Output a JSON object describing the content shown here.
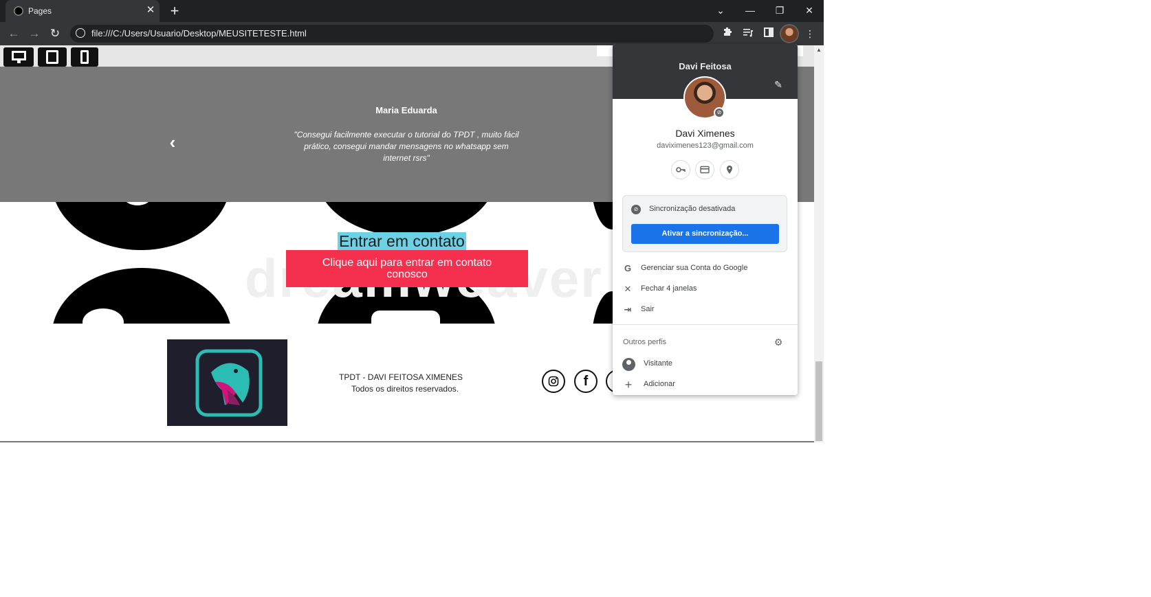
{
  "browser": {
    "tab_title": "Pages",
    "tab_close": "✕",
    "new_tab": "+",
    "url": "file:///C:/Users/Usuario/Desktop/MEUSITETESTE.html",
    "window_controls": {
      "tab_search": "⌄",
      "minimize": "—",
      "restore": "❐",
      "close": "✕"
    },
    "nav": {
      "back": "←",
      "forward": "→",
      "reload": "↻"
    },
    "toolbar_icons": {
      "extensions": "extensions-icon",
      "reading_list": "reading-list-icon",
      "side_panel": "side-panel-icon",
      "menu": "⋮"
    }
  },
  "page": {
    "device_buttons": [
      "desktop-icon",
      "tablet-icon",
      "mobile-icon"
    ],
    "testimonial": {
      "name": "Maria Eduarda",
      "quote": "\"Consegui facilmente executar o tutorial do TPDT , muito fácil prático, consegui mandar mensagens no whatsapp sem internet rsrs\"",
      "prev_arrow": "‹"
    },
    "contact": {
      "title": "Entrar em contato",
      "button_label": "Clique aqui para entrar em contato conosco"
    },
    "footer": {
      "line1": "TPDT - DAVI FEITOSA XIMENES",
      "line2": "Todos os direitos reservados.",
      "social_icons": [
        "instagram-icon",
        "facebook-icon",
        "whatsapp-icon"
      ],
      "social_glyphs": [
        "◎",
        "f",
        ""
      ]
    },
    "colors": {
      "testimonial_bg": "#787878",
      "contact_button": "#f5304e",
      "highlight": "#6bd1e4",
      "logo_bg": "#1e1e2c",
      "logo_accent": "#2bbcb3"
    }
  },
  "profile_menu": {
    "header_name": "Davi Feitosa",
    "edit": "✎",
    "full_name": "Davi Ximenes",
    "email": "daviximenes123@gmail.com",
    "quick_icons": [
      "password-key-icon",
      "payment-card-icon",
      "address-location-icon"
    ],
    "sync_status": "Sincronização desativada",
    "sync_button": "Ativar a sincronização...",
    "items": [
      {
        "icon": "G",
        "label": "Gerenciar sua Conta do Google"
      },
      {
        "icon": "✕",
        "label": "Fechar 4 janelas"
      },
      {
        "icon": "⇥",
        "label": "Sair"
      }
    ],
    "others_title": "Outros perfis",
    "others": [
      {
        "label": "Visitante"
      },
      {
        "label": "Adicionar"
      }
    ],
    "accent": "#1a73e8"
  }
}
